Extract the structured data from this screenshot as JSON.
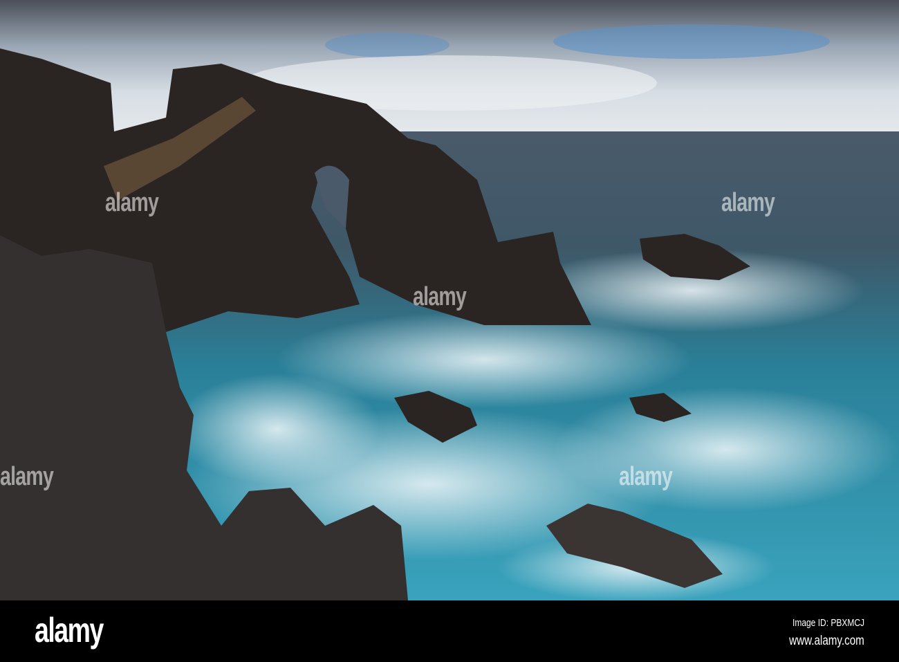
{
  "photo": {
    "subject": "Sea arch on rocky coastline with rough turquoise sea",
    "colors": {
      "sky": "#c9d3dc",
      "sea_far": "#4c5e6e",
      "sea_near": "#2f8fa8",
      "rock": "#2a2523",
      "foam": "#e6f1f4"
    }
  },
  "watermark": {
    "text": "alamy"
  },
  "footer": {
    "logo": "alamy",
    "image_id": "Image ID: PBXMCJ",
    "website": "www.alamy.com"
  }
}
